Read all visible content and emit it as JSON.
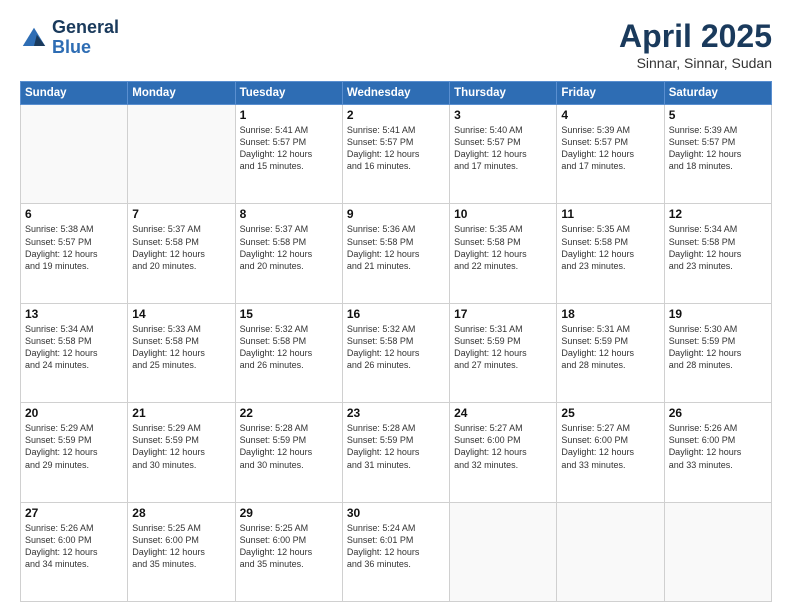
{
  "header": {
    "logo_line1": "General",
    "logo_line2": "Blue",
    "month_title": "April 2025",
    "location": "Sinnar, Sinnar, Sudan"
  },
  "weekdays": [
    "Sunday",
    "Monday",
    "Tuesday",
    "Wednesday",
    "Thursday",
    "Friday",
    "Saturday"
  ],
  "weeks": [
    [
      {
        "day": "",
        "info": ""
      },
      {
        "day": "",
        "info": ""
      },
      {
        "day": "1",
        "info": "Sunrise: 5:41 AM\nSunset: 5:57 PM\nDaylight: 12 hours\nand 15 minutes."
      },
      {
        "day": "2",
        "info": "Sunrise: 5:41 AM\nSunset: 5:57 PM\nDaylight: 12 hours\nand 16 minutes."
      },
      {
        "day": "3",
        "info": "Sunrise: 5:40 AM\nSunset: 5:57 PM\nDaylight: 12 hours\nand 17 minutes."
      },
      {
        "day": "4",
        "info": "Sunrise: 5:39 AM\nSunset: 5:57 PM\nDaylight: 12 hours\nand 17 minutes."
      },
      {
        "day": "5",
        "info": "Sunrise: 5:39 AM\nSunset: 5:57 PM\nDaylight: 12 hours\nand 18 minutes."
      }
    ],
    [
      {
        "day": "6",
        "info": "Sunrise: 5:38 AM\nSunset: 5:57 PM\nDaylight: 12 hours\nand 19 minutes."
      },
      {
        "day": "7",
        "info": "Sunrise: 5:37 AM\nSunset: 5:58 PM\nDaylight: 12 hours\nand 20 minutes."
      },
      {
        "day": "8",
        "info": "Sunrise: 5:37 AM\nSunset: 5:58 PM\nDaylight: 12 hours\nand 20 minutes."
      },
      {
        "day": "9",
        "info": "Sunrise: 5:36 AM\nSunset: 5:58 PM\nDaylight: 12 hours\nand 21 minutes."
      },
      {
        "day": "10",
        "info": "Sunrise: 5:35 AM\nSunset: 5:58 PM\nDaylight: 12 hours\nand 22 minutes."
      },
      {
        "day": "11",
        "info": "Sunrise: 5:35 AM\nSunset: 5:58 PM\nDaylight: 12 hours\nand 23 minutes."
      },
      {
        "day": "12",
        "info": "Sunrise: 5:34 AM\nSunset: 5:58 PM\nDaylight: 12 hours\nand 23 minutes."
      }
    ],
    [
      {
        "day": "13",
        "info": "Sunrise: 5:34 AM\nSunset: 5:58 PM\nDaylight: 12 hours\nand 24 minutes."
      },
      {
        "day": "14",
        "info": "Sunrise: 5:33 AM\nSunset: 5:58 PM\nDaylight: 12 hours\nand 25 minutes."
      },
      {
        "day": "15",
        "info": "Sunrise: 5:32 AM\nSunset: 5:58 PM\nDaylight: 12 hours\nand 26 minutes."
      },
      {
        "day": "16",
        "info": "Sunrise: 5:32 AM\nSunset: 5:58 PM\nDaylight: 12 hours\nand 26 minutes."
      },
      {
        "day": "17",
        "info": "Sunrise: 5:31 AM\nSunset: 5:59 PM\nDaylight: 12 hours\nand 27 minutes."
      },
      {
        "day": "18",
        "info": "Sunrise: 5:31 AM\nSunset: 5:59 PM\nDaylight: 12 hours\nand 28 minutes."
      },
      {
        "day": "19",
        "info": "Sunrise: 5:30 AM\nSunset: 5:59 PM\nDaylight: 12 hours\nand 28 minutes."
      }
    ],
    [
      {
        "day": "20",
        "info": "Sunrise: 5:29 AM\nSunset: 5:59 PM\nDaylight: 12 hours\nand 29 minutes."
      },
      {
        "day": "21",
        "info": "Sunrise: 5:29 AM\nSunset: 5:59 PM\nDaylight: 12 hours\nand 30 minutes."
      },
      {
        "day": "22",
        "info": "Sunrise: 5:28 AM\nSunset: 5:59 PM\nDaylight: 12 hours\nand 30 minutes."
      },
      {
        "day": "23",
        "info": "Sunrise: 5:28 AM\nSunset: 5:59 PM\nDaylight: 12 hours\nand 31 minutes."
      },
      {
        "day": "24",
        "info": "Sunrise: 5:27 AM\nSunset: 6:00 PM\nDaylight: 12 hours\nand 32 minutes."
      },
      {
        "day": "25",
        "info": "Sunrise: 5:27 AM\nSunset: 6:00 PM\nDaylight: 12 hours\nand 33 minutes."
      },
      {
        "day": "26",
        "info": "Sunrise: 5:26 AM\nSunset: 6:00 PM\nDaylight: 12 hours\nand 33 minutes."
      }
    ],
    [
      {
        "day": "27",
        "info": "Sunrise: 5:26 AM\nSunset: 6:00 PM\nDaylight: 12 hours\nand 34 minutes."
      },
      {
        "day": "28",
        "info": "Sunrise: 5:25 AM\nSunset: 6:00 PM\nDaylight: 12 hours\nand 35 minutes."
      },
      {
        "day": "29",
        "info": "Sunrise: 5:25 AM\nSunset: 6:00 PM\nDaylight: 12 hours\nand 35 minutes."
      },
      {
        "day": "30",
        "info": "Sunrise: 5:24 AM\nSunset: 6:01 PM\nDaylight: 12 hours\nand 36 minutes."
      },
      {
        "day": "",
        "info": ""
      },
      {
        "day": "",
        "info": ""
      },
      {
        "day": "",
        "info": ""
      }
    ]
  ]
}
